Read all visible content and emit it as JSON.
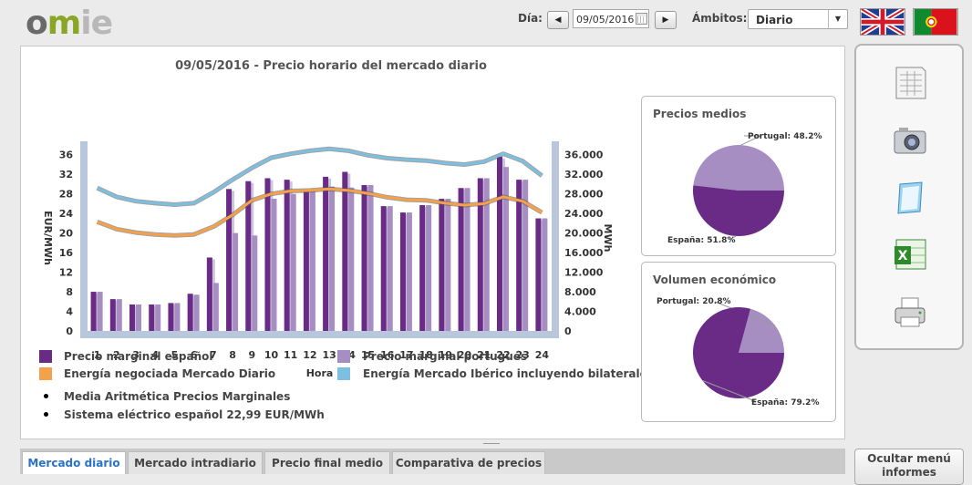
{
  "header": {
    "logo_text": "omie",
    "day_label": "Día:",
    "date_value": "09/05/2016",
    "scope_label": "Ámbitos:",
    "scope_value": "Diario"
  },
  "chart_title": "09/05/2016 - Precio horario del mercado diario",
  "chart_data": {
    "type": "bar",
    "title": "09/05/2016 - Precio horario del mercado diario",
    "xlabel": "Hora",
    "ylabel": "EUR/MWh",
    "y2label": "MWh",
    "categories": [
      "1",
      "2",
      "3",
      "4",
      "5",
      "6",
      "7",
      "8",
      "9",
      "10",
      "11",
      "12",
      "13",
      "14",
      "15",
      "16",
      "17",
      "18",
      "19",
      "20",
      "21",
      "22",
      "23",
      "24"
    ],
    "ylim": [
      0,
      38
    ],
    "yticks": [
      "0",
      "4",
      "8",
      "12",
      "16",
      "20",
      "24",
      "28",
      "32",
      "36"
    ],
    "y2lim": [
      0,
      38000
    ],
    "y2ticks": [
      "0",
      "4.000",
      "8.000",
      "12.000",
      "16.000",
      "20.000",
      "24.000",
      "28.000",
      "32.000",
      "36.000"
    ],
    "series": [
      {
        "name": "Precio marginal español",
        "type": "bar",
        "color": "#6a2b87",
        "values": [
          8.0,
          6.5,
          5.4,
          5.4,
          5.7,
          7.6,
          15.0,
          29.0,
          30.6,
          31.2,
          30.9,
          28.9,
          31.5,
          32.5,
          29.8,
          25.5,
          24.2,
          25.7,
          27.0,
          29.2,
          31.2,
          35.6,
          30.9,
          23.0
        ]
      },
      {
        "name": "Precio marginal portugués",
        "type": "bar",
        "color": "#a68ec3",
        "values": [
          8.0,
          6.5,
          5.4,
          5.4,
          5.7,
          7.4,
          9.8,
          20.0,
          19.5,
          27.0,
          28.0,
          28.9,
          29.5,
          29.3,
          29.8,
          25.5,
          24.2,
          25.7,
          27.0,
          29.2,
          31.2,
          33.5,
          30.9,
          23.0
        ]
      },
      {
        "name": "Energía negociada Mercado Diario",
        "type": "line",
        "color": "#f5a04a",
        "values": [
          22300,
          20800,
          20100,
          19700,
          19500,
          19700,
          21300,
          23700,
          26700,
          28000,
          28600,
          28700,
          29000,
          28700,
          28100,
          27300,
          26800,
          26700,
          26100,
          25700,
          26000,
          27400,
          26500,
          24200
        ]
      },
      {
        "name": "Energía Mercado Ibérico incluyendo bilaterales",
        "type": "line",
        "color": "#7cbfe0",
        "values": [
          29200,
          27400,
          26500,
          26100,
          25800,
          26100,
          28300,
          30900,
          33300,
          35400,
          36200,
          36800,
          37200,
          36800,
          35900,
          35300,
          35000,
          34800,
          34300,
          34000,
          34600,
          36200,
          34700,
          31700
        ]
      }
    ],
    "legend_position": "bottom"
  },
  "legend": {
    "spain": "Precio marginal español",
    "portugal": "Precio marginal portugués",
    "energy_daily": "Energía negociada Mercado Diario",
    "energy_iberian": "Energía Mercado Ibérico incluyendo bilaterales",
    "mean_prices": "Media Aritmética Precios Marginales",
    "spanish_system": "Sistema eléctrico español  22,99 EUR/MWh"
  },
  "pie_prices": {
    "title": "Precios medios",
    "slices": [
      {
        "label": "Portugal: 48.2%",
        "value": 48.2,
        "color": "#a68ec3"
      },
      {
        "label": "España: 51.8%",
        "value": 51.8,
        "color": "#6a2b87"
      }
    ]
  },
  "pie_volume": {
    "title": "Volumen económico",
    "slices": [
      {
        "label": "Portugal: 20.8%",
        "value": 20.8,
        "color": "#a68ec3"
      },
      {
        "label": "España: 79.2%",
        "value": 79.2,
        "color": "#6a2b87"
      }
    ]
  },
  "tabs": [
    "Mercado diario",
    "Mercado intradiario",
    "Precio final medio",
    "Comparativa de precios"
  ],
  "hide_button": "Ocultar menú informes"
}
